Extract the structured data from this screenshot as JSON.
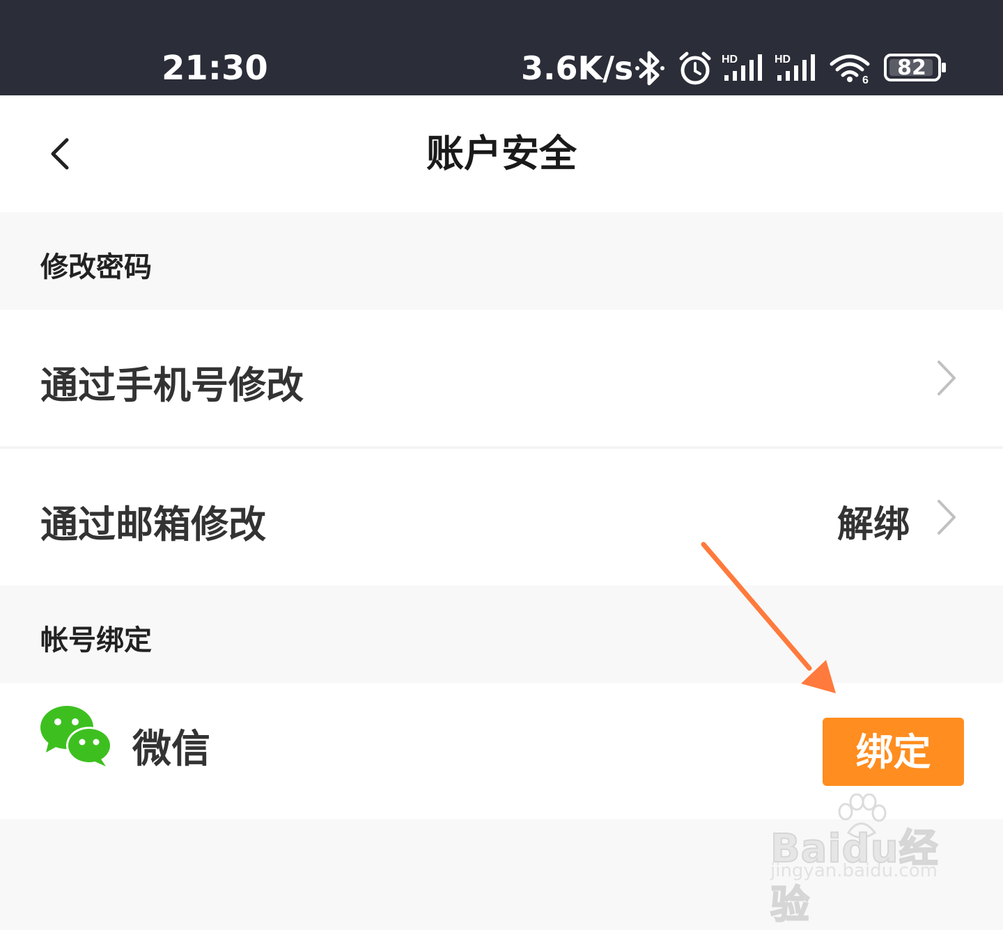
{
  "status_bar": {
    "time": "21:30",
    "net_speed": "3.6K/s",
    "battery": "82",
    "icons": [
      "bluetooth-icon",
      "alarm-icon",
      "signal-hd-icon",
      "signal-hd-icon",
      "wifi-icon",
      "battery-icon"
    ]
  },
  "header": {
    "title": "账户安全",
    "back_icon": "chevron-left-icon"
  },
  "sections": {
    "password": {
      "title": "修改密码",
      "rows": [
        {
          "label": "通过手机号修改",
          "value": ""
        },
        {
          "label": "通过邮箱修改",
          "value": "解绑"
        }
      ]
    },
    "binding": {
      "title": "帐号绑定",
      "wechat_label": "微信",
      "bind_button": "绑定"
    }
  },
  "colors": {
    "status_bar_bg": "#2b2d38",
    "accent_orange": "#ff8d1f",
    "wechat_green": "#3dc01f",
    "annotation_arrow": "#ff7a3c"
  },
  "watermark": {
    "brand": "Baidu经验",
    "url": "jingyan.baidu.com"
  }
}
